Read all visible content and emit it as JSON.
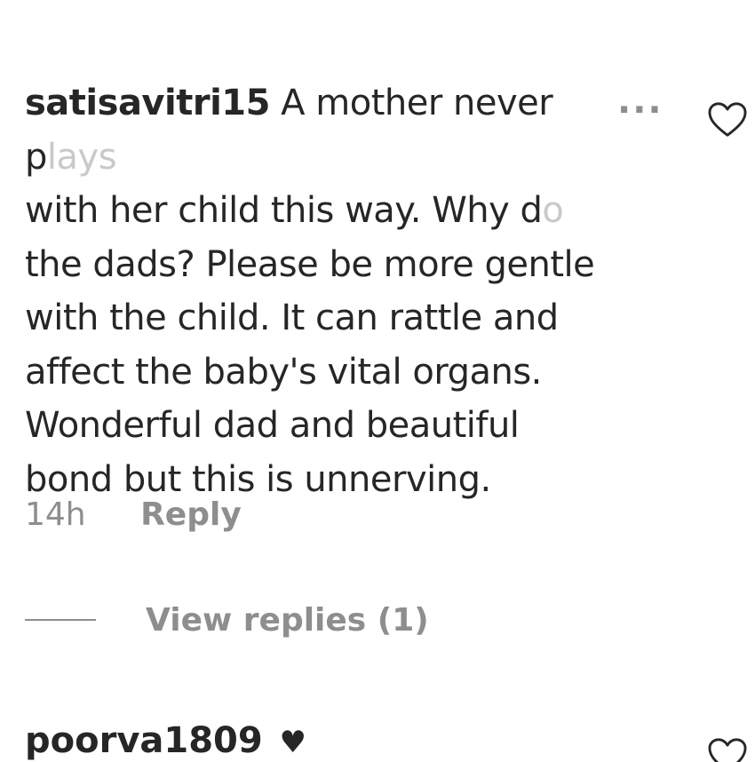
{
  "comment": {
    "username": "satisavitri15",
    "line1_text": "A mother never p",
    "line1_fade": "lays",
    "line2_text": "with her child this way. Why d",
    "line2_fade": "o",
    "lines": [
      "the dads? Please be more gentle",
      "with the child. It can rattle and",
      "affect the baby's vital organs.",
      "Wonderful dad and beautiful",
      "bond but this is unnerving."
    ],
    "more_label": "...",
    "time": "14h",
    "reply_label": "Reply",
    "view_replies_label": "View replies (1)"
  },
  "comment2": {
    "username": "poorva1809",
    "text": "♥"
  },
  "icons": {
    "like": "heart-outline-icon",
    "more": "ellipsis-icon"
  },
  "colors": {
    "text": "#262626",
    "secondary": "#8e8e8e"
  }
}
